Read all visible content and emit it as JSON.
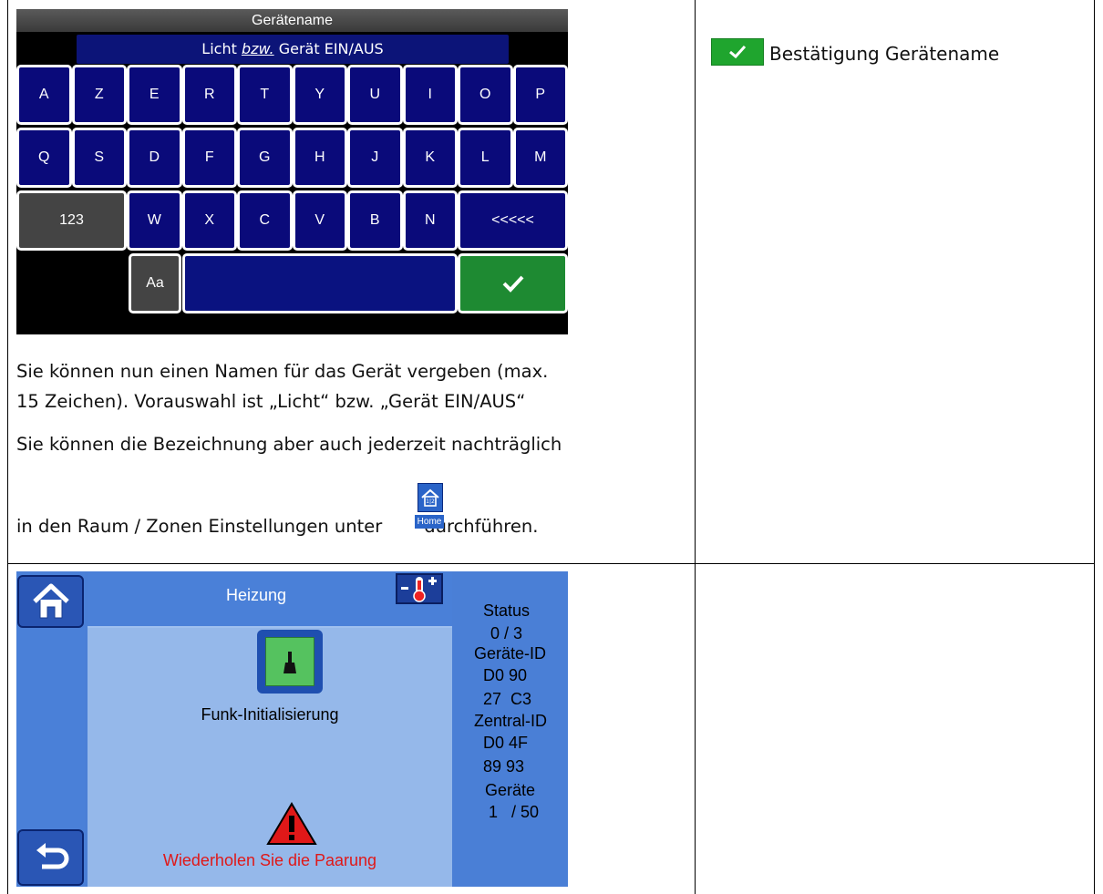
{
  "keyboard": {
    "title": "Gerätename",
    "input_emph": "bzw.",
    "input_pre": "Licht ",
    "input_post": " Gerät EIN/AUS",
    "row1": [
      "A",
      "Z",
      "E",
      "R",
      "T",
      "Y",
      "U",
      "I",
      "O",
      "P"
    ],
    "row2": [
      "Q",
      "S",
      "D",
      "F",
      "G",
      "H",
      "J",
      "K",
      "L",
      "M"
    ],
    "row3": [
      "W",
      "X",
      "C",
      "V",
      "B",
      "N"
    ],
    "key_123": "123",
    "key_backspace": "<<<<<",
    "key_case": "Aa",
    "confirm_icon": "checkmark-icon",
    "colors": {
      "key_blue": "#0a0a7a",
      "key_gray": "#444444",
      "confirm_green": "#1e8a32"
    }
  },
  "right_column": {
    "confirm_label": "Bestätigung Gerätename",
    "confirm_icon": "checkmark-icon"
  },
  "text": {
    "p1_line1": "Sie können nun einen Namen für das Gerät vergeben (max.",
    "p1_line2": "15 Zeichen). Vorauswahl ist „Licht“ bzw. „Gerät EIN/AUS“",
    "p2_line1": "Sie können die Bezeichnung aber auch jederzeit nachträglich",
    "p2_line2_pre": "in den Raum / Zonen Einstellungen unter",
    "p2_line2_post": "durchführen.",
    "home_icon_label": "Home"
  },
  "heizung": {
    "title": "Heizung",
    "init_label": "Funk-Initialisierung",
    "warning": "Wiederholen Sie die Paarung",
    "status": {
      "status_label": "Status",
      "status_value": "0 / 3",
      "device_id_label": "Geräte-ID",
      "device_id_1": "D0 90",
      "device_id_2": "27  C3",
      "central_id_label": "Zentral-ID",
      "central_id_1": "D0 4F",
      "central_id_2": "89 93",
      "devices_label": "Geräte",
      "devices_value": "1   / 50"
    },
    "icons": [
      "home-icon",
      "thermometer-plus-minus-icon",
      "init-switch-icon",
      "warning-icon",
      "back-icon"
    ],
    "colors": {
      "panel": "#4a80d8",
      "main": "#95b8ea",
      "warning": "#e01818"
    }
  }
}
